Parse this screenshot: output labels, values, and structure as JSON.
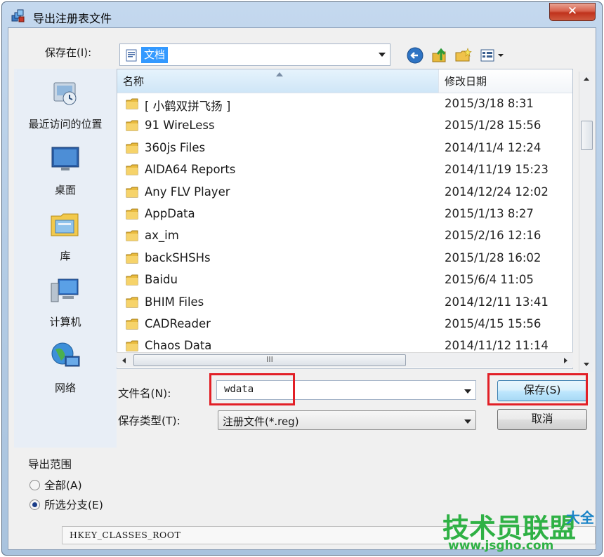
{
  "window": {
    "title": "导出注册表文件",
    "close_label": "✕"
  },
  "toolbar": {
    "save_in_label": "保存在(I):",
    "save_in_value": "文档",
    "back_icon": "back-arrow-icon",
    "up_icon": "up-folder-icon",
    "new_folder_icon": "new-folder-icon",
    "view_icon": "view-menu-icon"
  },
  "places": [
    {
      "label": "最近访问的位置",
      "icon": "recent-places-icon"
    },
    {
      "label": "桌面",
      "icon": "desktop-icon"
    },
    {
      "label": "库",
      "icon": "libraries-icon"
    },
    {
      "label": "计算机",
      "icon": "computer-icon"
    },
    {
      "label": "网络",
      "icon": "network-icon"
    }
  ],
  "filelist": {
    "columns": {
      "name": "名称",
      "date": "修改日期"
    },
    "rows": [
      {
        "name": "[ 小鹤双拼飞扬 ]",
        "date": "2015/3/18 8:31"
      },
      {
        "name": "91 WireLess",
        "date": "2015/1/28 15:56"
      },
      {
        "name": "360js Files",
        "date": "2014/11/4 12:24"
      },
      {
        "name": "AIDA64 Reports",
        "date": "2014/11/19 15:23"
      },
      {
        "name": "Any FLV Player",
        "date": "2014/12/24 12:02"
      },
      {
        "name": "AppData",
        "date": "2015/1/13 8:27"
      },
      {
        "name": "ax_im",
        "date": "2015/2/16 12:16"
      },
      {
        "name": "backSHSHs",
        "date": "2015/1/28 16:02"
      },
      {
        "name": "Baidu",
        "date": "2015/6/4 11:05"
      },
      {
        "name": "BHIM Files",
        "date": "2014/12/11 13:41"
      },
      {
        "name": "CADReader",
        "date": "2015/4/15 15:56"
      },
      {
        "name": "Chaos Data",
        "date": "2014/11/12 11:14"
      }
    ],
    "hscroll_grip": "III"
  },
  "form": {
    "filename_label": "文件名(N):",
    "filename_value": "wdata",
    "filetype_label": "保存类型(T):",
    "filetype_value": "注册文件(*.reg)",
    "save_button": "保存(S)",
    "cancel_button": "取消"
  },
  "export_range": {
    "title": "导出范围",
    "option_all": "全部(A)",
    "option_branch": "所选分支(E)",
    "selected": "branch",
    "branch_value": "HKEY_CLASSES_ROOT"
  },
  "watermark": {
    "main": "技术员联盟",
    "url": "www.jsgho.com",
    "extra": "大全"
  },
  "colors": {
    "highlight": "#3399ff",
    "annotation_red": "#e21f26",
    "watermark_green": "#2fb145"
  }
}
